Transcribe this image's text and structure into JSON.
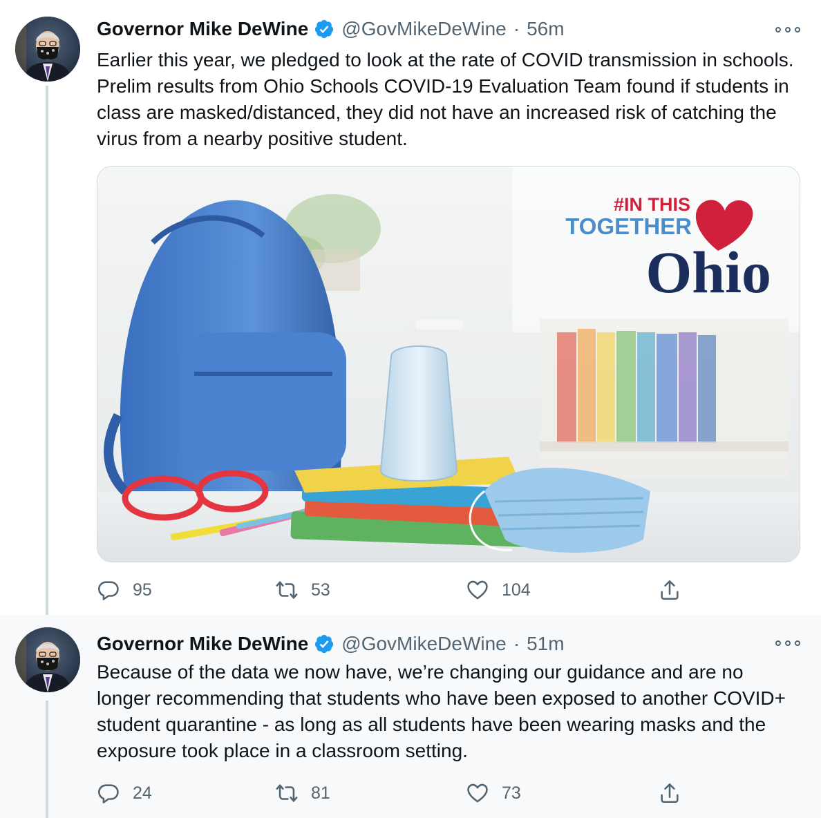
{
  "tweets": [
    {
      "author_name": "Governor Mike DeWine",
      "handle": "@GovMikeDeWine",
      "separator": "·",
      "time": "56m",
      "text": "Earlier this year, we pledged to look at the rate of COVID transmission in schools. Prelim results from Ohio Schools COVID-19 Evaluation Team found if students in class are masked/distanced, they did not have an increased risk of catching the virus from a nearby positive student.",
      "media": {
        "logo_line1": "#IN THIS",
        "logo_line2": "TOGETHER",
        "logo_line3": "Ohio"
      },
      "replies": "95",
      "retweets": "53",
      "likes": "104"
    },
    {
      "author_name": "Governor Mike DeWine",
      "handle": "@GovMikeDeWine",
      "separator": "·",
      "time": "51m",
      "text": "Because of the data we now have, we’re changing our guidance and are no longer recommending that students who have been exposed to another COVID+ student quarantine - as long as all students have been wearing masks and the exposure took place in a classroom setting.",
      "replies": "24",
      "retweets": "81",
      "likes": "73"
    }
  ],
  "colors": {
    "verified_blue": "#1d9bf0",
    "secondary_text": "#536471",
    "logo_red": "#d1203b",
    "logo_light_blue": "#4b8cc9",
    "logo_navy": "#1c2f5c"
  },
  "icons": [
    "verified-badge-icon",
    "more-icon",
    "reply-icon",
    "retweet-icon",
    "like-icon",
    "share-icon"
  ]
}
